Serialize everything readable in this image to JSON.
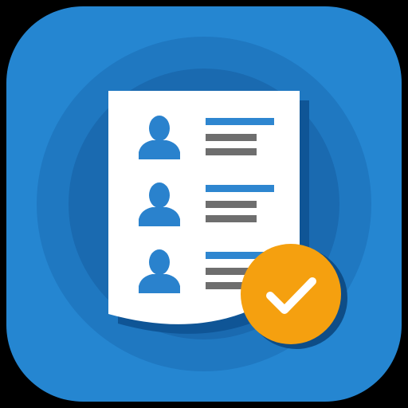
{
  "icon": {
    "kind": "app-icon",
    "subject": "contact-list-document-with-checkmark",
    "colors": {
      "background": "#000000",
      "tile": "#2586D1",
      "ring_outer": "#1F78C1",
      "ring_inner": "#1A6AB0",
      "document": "#FFFFFF",
      "document_shadow": "#0F5596",
      "person": "#2A82CD",
      "title_line": "#2E86D0",
      "text_line": "#6E6E6E",
      "badge": "#F5A00F",
      "badge_shadow": "#0E4D87",
      "check": "#FFFFFF"
    },
    "entries": [
      {
        "avatar": "person-icon",
        "line_count": 3
      },
      {
        "avatar": "person-icon",
        "line_count": 3
      },
      {
        "avatar": "person-icon",
        "line_count": 3
      }
    ],
    "badge": {
      "icon": "checkmark-icon",
      "state": "checked"
    }
  }
}
